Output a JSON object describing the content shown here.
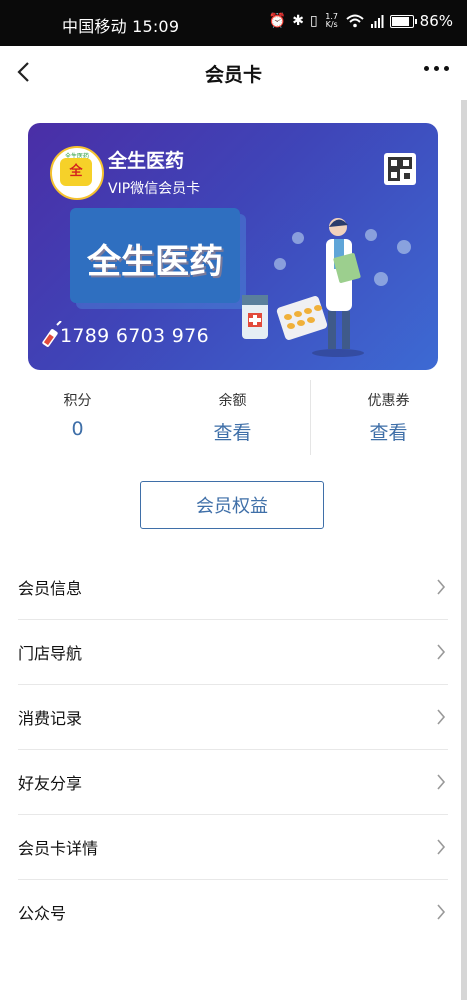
{
  "status_bar": {
    "carrier_time": "中国移动 15:09",
    "net_speed_value": "1.7",
    "net_speed_unit": "K/s",
    "battery": "86%",
    "battery_level": 0.86,
    "icons": [
      "alarm-icon",
      "bluetooth-icon",
      "vibrate-icon",
      "wifi-icon",
      "signal-icon",
      "battery-icon"
    ]
  },
  "navbar": {
    "title": "会员卡"
  },
  "card": {
    "brand": "全生医药",
    "subtitle": "VIP微信会员卡",
    "banner_text": "全生医药",
    "card_number": "1789 6703 976",
    "logo_text": "全",
    "logo_ring_text": "全生医药",
    "colors": {
      "start": "#4a2ea6",
      "end": "#3d6ad3"
    }
  },
  "stats": [
    {
      "label": "积分",
      "value": "0"
    },
    {
      "label": "余额",
      "value": "查看"
    },
    {
      "label": "优惠券",
      "value": "查看"
    }
  ],
  "benefit_button": "会员权益",
  "menu": [
    {
      "label": "会员信息"
    },
    {
      "label": "门店导航"
    },
    {
      "label": "消费记录"
    },
    {
      "label": "好友分享"
    },
    {
      "label": "会员卡详情"
    },
    {
      "label": "公众号"
    }
  ],
  "accent_color": "#3f6fa8"
}
